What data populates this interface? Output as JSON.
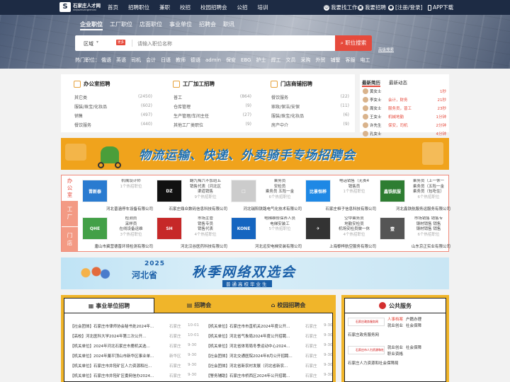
{
  "topbar": {
    "logo_title": "石家庄人才网",
    "logo_sub": "shijiazhuangrencai",
    "nav": [
      "首页",
      "招聘职位",
      "兼职",
      "校招",
      "校园招聘会",
      "公招",
      "培训"
    ],
    "find_job": "我要找工作",
    "recruit": "我要招聘",
    "login": "[注册/登录]",
    "app": "APP下载"
  },
  "search": {
    "tabs": [
      "企业职位",
      "工厂职位",
      "店面职位",
      "事业单位",
      "招聘会",
      "职讯"
    ],
    "area": "区域",
    "badge": "更多",
    "placeholder": "请输入职位名称",
    "button": "职位搜索",
    "advanced": "高级搜索",
    "hot_label": "热门职位：",
    "hot": [
      "俄语",
      "英语",
      "司机",
      "会计",
      "日语",
      "教师",
      "德语",
      "admin",
      "保安",
      "EBG",
      "护士",
      "焊工",
      "文员",
      "采购",
      "外贸",
      "铺警",
      "客服",
      "电工"
    ]
  },
  "categories": [
    {
      "title": "办公室招聘",
      "items": [
        {
          "n": "其它类",
          "c": "(2450)"
        },
        {
          "n": "服装/珠宝/化妆品",
          "c": "(602)"
        },
        {
          "n": "销售",
          "c": "(497)"
        },
        {
          "n": "餐饮服务",
          "c": "(440)"
        }
      ]
    },
    {
      "title": "工厂加工招聘",
      "items": [
        {
          "n": "普工",
          "c": "(864)"
        },
        {
          "n": "仓库管理",
          "c": "(9)"
        },
        {
          "n": "生产管理/车间主任",
          "c": "(27)"
        },
        {
          "n": "其他工厂类职位",
          "c": "(9)"
        }
      ]
    },
    {
      "title": "门店商铺招聘",
      "items": [
        {
          "n": "餐饮服务",
          "c": "(22)"
        },
        {
          "n": "家政/保洁/安保",
          "c": "(11)"
        },
        {
          "n": "服装/珠宝/化妆品",
          "c": "(6)"
        },
        {
          "n": "房产中介",
          "c": "(9)"
        }
      ]
    }
  ],
  "resumes": {
    "tabs": [
      "最新简历",
      "最新动态"
    ],
    "items": [
      {
        "name": "黄女士",
        "job": "",
        "time": "1秒"
      },
      {
        "name": "李女士",
        "job": "会计，财务",
        "time": "21秒"
      },
      {
        "name": "周女士",
        "job": "服务员，普工",
        "time": "23秒"
      },
      {
        "name": "王女士",
        "job": "机械地勤",
        "time": "1分钟"
      },
      {
        "name": "许先生",
        "job": "保安，司机",
        "time": "2分钟"
      },
      {
        "name": "孔女士",
        "job": "",
        "time": "4分钟"
      }
    ]
  },
  "banner1": {
    "text": "物流运输、快递、外卖骑手专场招聘会"
  },
  "companies_side": [
    "办\n公\n室",
    "工\n厂",
    "门\n店"
  ],
  "companies": [
    {
      "logo": "晋新泰",
      "logo_color": "#2a7bd0",
      "jobs": [
        "机械设计师"
      ],
      "more": "1个热招职位",
      "name": "河北晋涵停车设备有限公司"
    },
    {
      "logo": "DZ",
      "logo_color": "#111",
      "jobs": [
        "翻九梅六不加班五",
        "销售代表（河北区",
        "渠道销售"
      ],
      "more": "9个热招职位",
      "name": "石家庄鼎众数码信息科技有限公司"
    },
    {
      "logo": "□",
      "logo_color": "#ccc",
      "jobs": [
        "乘务员",
        "安检员",
        "乘务员 五险一金"
      ],
      "more": "6个热招职位",
      "name": "河北瑞阳铁路电气化技术有限公司"
    },
    {
      "logo": "比景恒桦",
      "logo_color": "#1e88e5",
      "jobs": [
        "电话销售（无责4",
        "销售员"
      ],
      "more": "1个热招职位",
      "name": "石家庄桓子信息科技有限公司"
    },
    {
      "logo": "鑫铁航服",
      "logo_color": "#2e7d32",
      "jobs": [
        "乘务员（上一休一",
        "乘务员（五险一金",
        "乘务员（包吃住）"
      ],
      "more": "6个热招职位",
      "name": "河北鑫铁航服务运服务有限公司"
    },
    {
      "logo": "QHE",
      "logo_color": "#43a047",
      "jobs": [
        "检测员",
        "采样员",
        "在线设备运维"
      ],
      "more": "3个热招职位",
      "name": "唐山市冀营德晋环境检测有限公司"
    },
    {
      "logo": "SH",
      "logo_color": "#c62828",
      "jobs": [
        "市场主管",
        "销售专员",
        "销售代表"
      ],
      "more": "4个热招职位",
      "name": "河北汉谷医药科技有限公司"
    },
    {
      "logo": "KONE",
      "logo_color": "#1565c0",
      "jobs": [
        "电梯维修保养人员",
        "电梯安装工"
      ],
      "more": "5个热招职位",
      "name": "河北远安电梯安装有限公司"
    },
    {
      "logo": "✈",
      "logo_color": "#333",
      "jobs": [
        "空中乘务员",
        "地勤安检员",
        "机场安检员做一休"
      ],
      "more": "4个热招职位",
      "name": "上海黎梓航空服务有限公司"
    },
    {
      "logo": "壹",
      "logo_color": "#555",
      "jobs": [
        "市场销售 销售专",
        "钢材销售 销售",
        "钢材销售 销售"
      ],
      "more": "6个热招职位",
      "name": "山东京正实业有限公司"
    }
  ],
  "banner2": {
    "year": "2025",
    "prov": "河北省",
    "big": "秋季网络双选会",
    "sub": "普通高校毕业生"
  },
  "news_tabs": [
    "事业单位招聘",
    "招聘会",
    "校园招聘会"
  ],
  "news": [
    {
      "t": "【社会团体】石家庄市律师协会秘书处2024年...",
      "c": "石家庄",
      "d": "10-01"
    },
    {
      "t": "【高校】河北医科大学2024年第二次公开...",
      "c": "石家庄",
      "d": "10-01"
    },
    {
      "t": "【机关单位】2024年河北石家庄市鹿机关选...",
      "c": "石家庄",
      "d": "9-30"
    },
    {
      "t": "【机关单位】2024年藁平顶山市新华区事业单...",
      "c": "新华区",
      "d": "9-30"
    },
    {
      "t": "【机关单位】石家庄市井陉矿区人力资源和社...",
      "c": "石家庄",
      "d": "9-30"
    },
    {
      "t": "【机关单位】石家庄市井陉矿区委网信办2024...",
      "c": "石家庄",
      "d": "9-30"
    },
    {
      "t": "【机关单位】石家庄市市直机关2024年度公开...",
      "c": "石家庄",
      "d": "9-30"
    },
    {
      "t": "【机关单位】河北省气象局2024年度公开招聘...",
      "c": "石家庄",
      "d": "9-30"
    },
    {
      "t": "【机关单位】河北省体育局冬季运动中心2024...",
      "c": "石家庄",
      "d": "9-30"
    },
    {
      "t": "【社会团体】河北交通医院2024年8月公开招聘...",
      "c": "石家庄",
      "d": "9-30"
    },
    {
      "t": "【社会团体】河北省新农村发展（河北省新农...",
      "c": "石家庄",
      "d": "9-30"
    },
    {
      "t": "【警务辅助】石家庄市桥西区2024年公开招聘...",
      "c": "石家庄",
      "d": "9-30"
    }
  ],
  "service": {
    "title": "公共服务",
    "rows": [
      {
        "logo": "石家庄政务服务网",
        "links": [
          "人事档案",
          "户籍办理",
          "就业创业",
          "社会保障"
        ],
        "foot": "石家庄政务服务网"
      },
      {
        "logo": "石家庄市人力资源和社会保障局",
        "links": [
          "就业创业",
          "社会保障",
          "职业资格"
        ],
        "foot": "石家庄人力资源和社会保障局"
      }
    ]
  }
}
